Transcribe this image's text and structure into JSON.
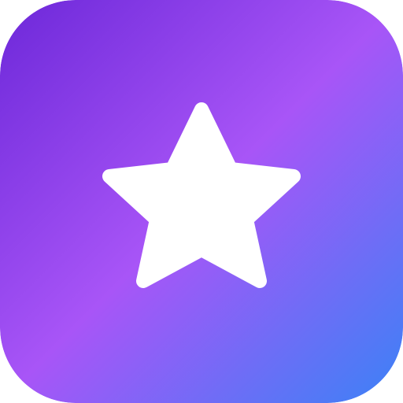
{
  "icon": {
    "name": "star-icon",
    "colors": {
      "gradient_start": "#6d28d9",
      "gradient_mid": "#a855f7",
      "gradient_end": "#3b82f6",
      "star_fill": "#ffffff"
    }
  }
}
